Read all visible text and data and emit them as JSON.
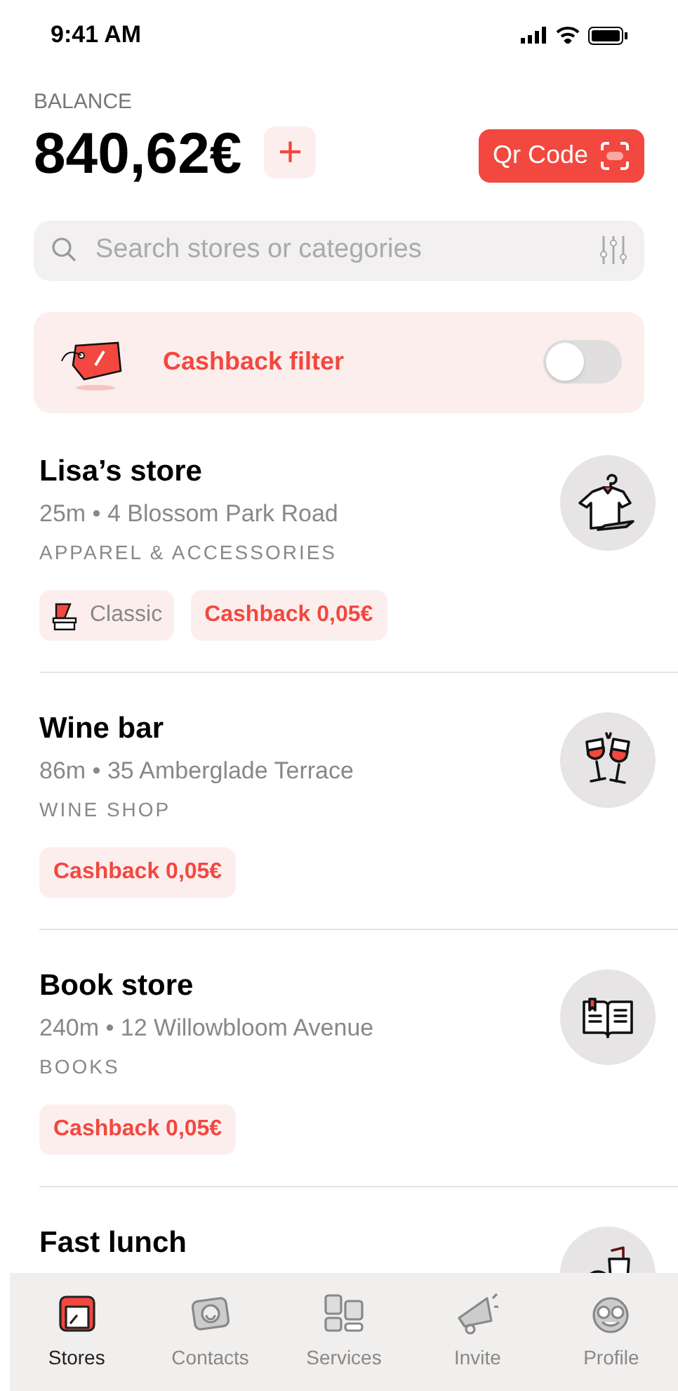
{
  "status_bar": {
    "time": "9:41 AM"
  },
  "balance": {
    "label": "BALANCE",
    "amount": "840,62€",
    "add_icon": "+"
  },
  "qr_button": {
    "label": "Qr Code"
  },
  "search": {
    "placeholder": "Search stores or categories"
  },
  "cashback_filter": {
    "label": "Cashback filter",
    "on": false
  },
  "stores": [
    {
      "name": "Lisa’s store",
      "address": "25m • 4 Blossom Park Road",
      "category": "APPAREL & ACCESSORIES",
      "badges": [
        {
          "kind": "plan",
          "label": "Classic"
        },
        {
          "kind": "cashback",
          "label": "Cashback 0,05€"
        }
      ]
    },
    {
      "name": "Wine bar",
      "address": "86m • 35 Amberglade Terrace",
      "category": "WINE SHOP",
      "badges": [
        {
          "kind": "cashback",
          "label": "Cashback 0,05€"
        }
      ]
    },
    {
      "name": "Book store",
      "address": "240m •  12 Willowbloom Avenue",
      "category": "BOOKS",
      "badges": [
        {
          "kind": "cashback",
          "label": "Cashback 0,05€"
        }
      ]
    },
    {
      "name": "Fast lunch"
    }
  ],
  "tab_bar": [
    {
      "label": "Stores",
      "selected": true
    },
    {
      "label": "Contacts",
      "selected": false
    },
    {
      "label": "Services",
      "selected": false
    },
    {
      "label": "Invite",
      "selected": false
    },
    {
      "label": "Profile",
      "selected": false
    }
  ]
}
